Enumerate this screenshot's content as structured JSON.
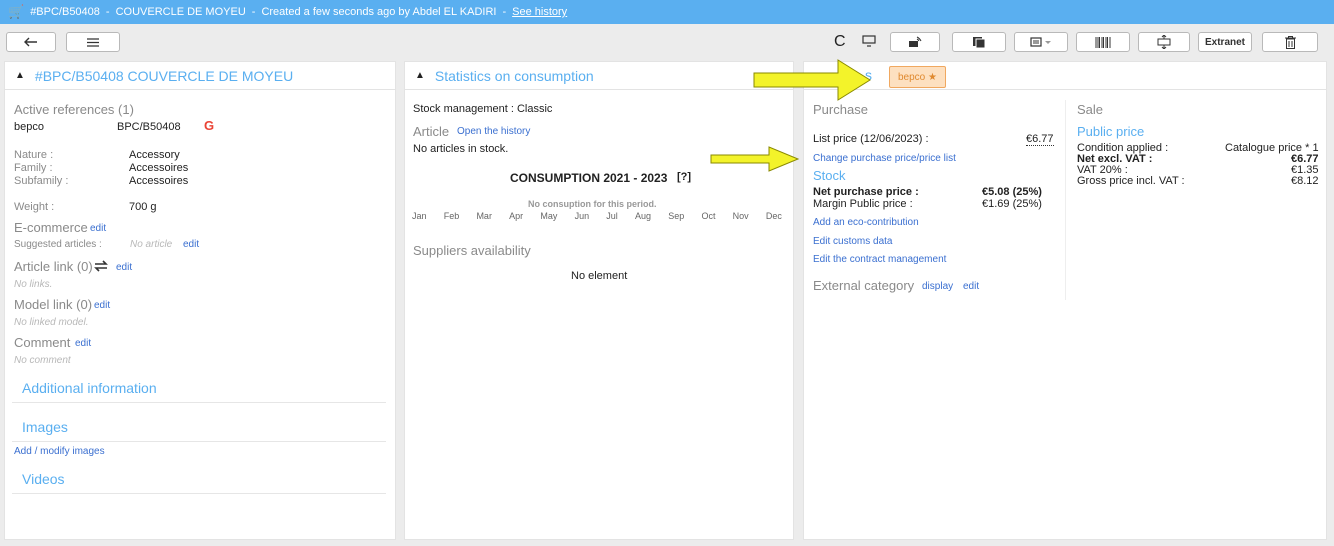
{
  "titlebar": {
    "ref": "#BPC/B50408",
    "name": "COUVERCLE DE MOYEU",
    "created": "Created a few seconds ago by Abdel EL KADIRI",
    "history_link": "See history",
    "separator": "-"
  },
  "toolbar": {
    "extranet_label": "Extranet"
  },
  "left": {
    "header": "#BPC/B50408 COUVERCLE DE MOYEU",
    "active_refs_title": "Active references (1)",
    "ref_supplier": "bepco",
    "ref_code": "BPC/B50408",
    "google_letter": "G",
    "nature_label": "Nature :",
    "nature_value": "Accessory",
    "family_label": "Family :",
    "family_value": "Accessoires",
    "subfamily_label": "Subfamily :",
    "subfamily_value": "Accessoires",
    "weight_label": "Weight :",
    "weight_value": "700 g",
    "ecommerce_title": "E-commerce",
    "edit": "edit",
    "suggested_label": "Suggested articles :",
    "suggested_value": "No article",
    "article_link_title": "Article link (0)",
    "no_links": "No links.",
    "model_link_title": "Model link (0)",
    "no_model": "No linked model.",
    "comment_title": "Comment",
    "no_comment": "No comment",
    "additional_info": "Additional information",
    "images_title": "Images",
    "add_images": "Add / modify images",
    "videos_title": "Videos"
  },
  "middle": {
    "header": "Statistics on consumption",
    "stock_mgmt": "Stock management : Classic",
    "article_title": "Article",
    "open_history": "Open the history",
    "no_articles": "No articles in stock.",
    "consumption_title": "CONSUMPTION 2021 - 2023",
    "help": "[?]",
    "no_consumption": "No consuption for this period.",
    "months": [
      "Jan",
      "Feb",
      "Mar",
      "Apr",
      "May",
      "Jun",
      "Jul",
      "Aug",
      "Sep",
      "Oct",
      "Nov",
      "Dec"
    ],
    "suppliers_title": "Suppliers availability",
    "no_element": "No element"
  },
  "right": {
    "header_partial": "s",
    "badge": "bepco ★",
    "purchase_title": "Purchase",
    "list_price_label": "List price (12/06/2023) :",
    "list_price_value": "€6.77",
    "change_price_link": "Change purchase price/price list",
    "stock_title": "Stock",
    "net_purchase_label": "Net purchase price :",
    "net_purchase_value": "€5.08 (25%)",
    "margin_label": "Margin Public price :",
    "margin_value": "€1.69 (25%)",
    "eco_link": "Add an eco-contribution",
    "customs_link": "Edit customs data",
    "contract_link": "Edit the contract management",
    "external_cat_title": "External category",
    "display_link": "display",
    "edit": "edit",
    "sale_title": "Sale",
    "public_price_title": "Public price",
    "condition_label": "Condition applied :",
    "condition_value": "Catalogue price * 1",
    "net_excl_label": "Net excl. VAT :",
    "net_excl_value": "€6.77",
    "vat_label": "VAT 20% :",
    "vat_value": "€1.35",
    "gross_label": "Gross price incl. VAT :",
    "gross_value": "€8.12"
  },
  "colors": {
    "titlebar": "#5aaff0",
    "accent_blue": "#5aaff0",
    "link": "#3a6fd0",
    "badge_bg": "#fde0c0",
    "arrow": "#f3f32a"
  }
}
